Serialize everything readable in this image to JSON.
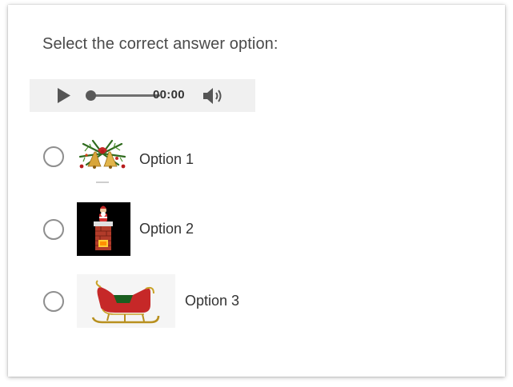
{
  "question": {
    "text": "Select the correct answer option:"
  },
  "audio_player": {
    "time": "00:00",
    "progress": 0,
    "icons": [
      "play-icon",
      "volume-icon"
    ]
  },
  "options": [
    {
      "label": "Option 1",
      "image": "christmas-bells-image"
    },
    {
      "label": "Option 2",
      "image": "santa-chimney-image"
    },
    {
      "label": "Option 3",
      "image": "santa-sleigh-image"
    }
  ],
  "colors": {
    "card_bg": "#ffffff",
    "audio_bg": "#f0f0f0",
    "radio_border": "#8e8e8e",
    "text": "#333333"
  }
}
